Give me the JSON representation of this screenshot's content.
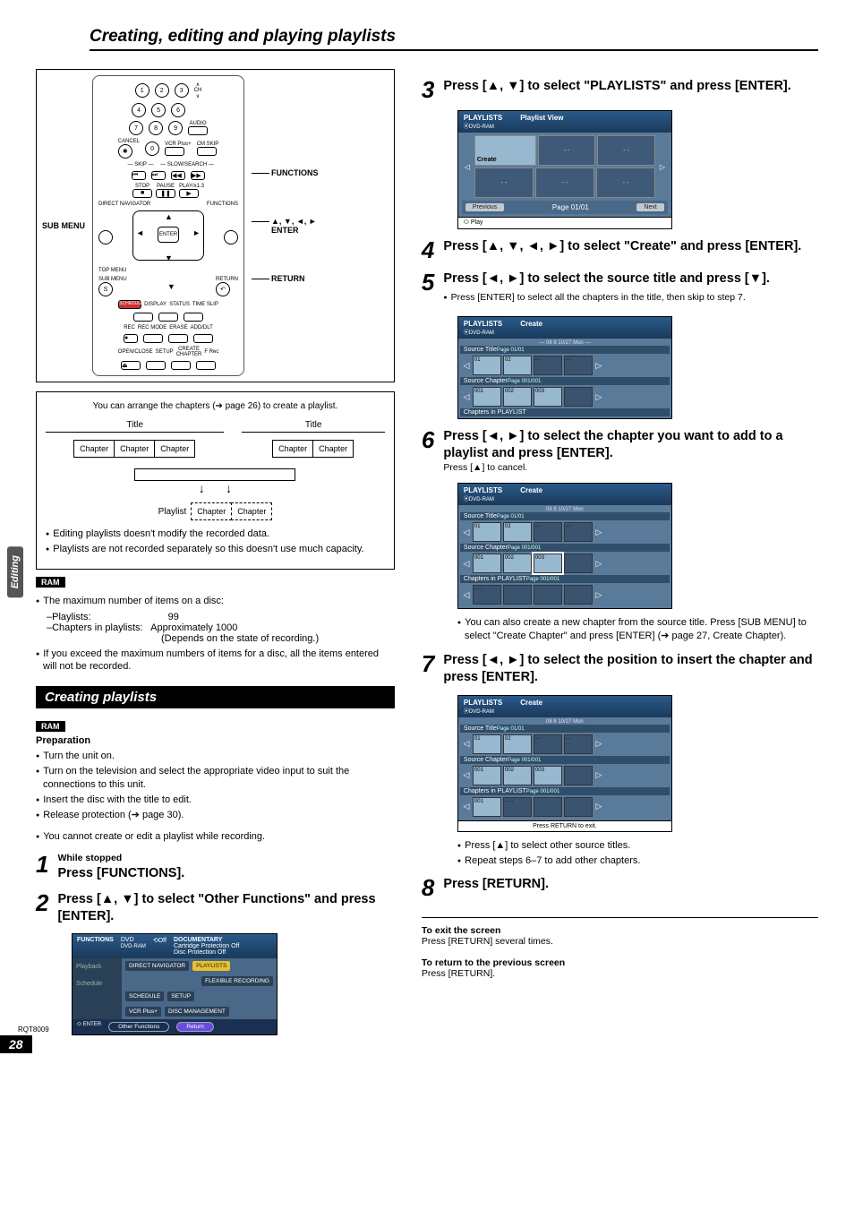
{
  "page": {
    "title": "Creating, editing and playing playlists",
    "side_tab": "Editing",
    "footer_code": "RQT8009",
    "page_number": "28"
  },
  "remote_labels": {
    "sub_menu": "SUB MENU",
    "functions": "FUNCTIONS",
    "arrows_enter": "▲, ▼, ◄, ►\nENTER",
    "return": "RETURN",
    "enter_btn": "ENTER"
  },
  "explain": {
    "intro": "You can arrange the chapters (➔ page 26) to create a playlist.",
    "title_label": "Title",
    "chapter_label": "Chapter",
    "playlist_label": "Playlist",
    "points": [
      "Editing playlists doesn't modify the recorded data.",
      "Playlists are not recorded separately so this doesn't use much capacity."
    ]
  },
  "ram_info": {
    "line1": "The maximum number of items on a disc:",
    "pl_label": "–Playlists:",
    "pl_val": "99",
    "ch_label": "–Chapters in playlists:",
    "ch_val": "Approximately 1000",
    "ch_note": "(Depends on the state of recording.)",
    "line2": "If you exceed the maximum numbers of items for a disc, all the items entered will not be recorded."
  },
  "section_header": "Creating playlists",
  "prep": {
    "label": "Preparation",
    "items": [
      "Turn the unit on.",
      "Turn on the television and select the appropriate video input to suit the connections to this unit.",
      "Insert the disc with the title to edit.",
      "Release protection (➔ page 30)."
    ],
    "note": "You cannot create or edit a playlist while recording."
  },
  "steps": {
    "s1_pre": "While stopped",
    "s1": "Press [FUNCTIONS].",
    "s2": "Press [▲, ▼] to select \"Other Functions\" and press [ENTER].",
    "s3": "Press [▲, ▼] to select \"PLAYLISTS\" and press [ENTER].",
    "s4": "Press [▲, ▼, ◄, ►] to select \"Create\" and press [ENTER].",
    "s5": "Press [◄, ►] to select the source title and press [▼].",
    "s5_sub": "Press [ENTER] to select all the chapters in the title, then skip to step 7.",
    "s6": "Press [◄, ►] to select the chapter you want to add to a playlist and press [ENTER].",
    "s6_sub": "Press [▲] to cancel.",
    "s6_note": "You can also create a new chapter from the source title. Press [SUB MENU] to select \"Create Chapter\" and press [ENTER] (➔ page 27, Create Chapter).",
    "s7": "Press [◄, ►] to select the position to insert the chapter and press [ENTER].",
    "s7_n1": "Press [▲] to select other source titles.",
    "s7_n2": "Repeat steps 6–7 to add other chapters.",
    "s8": "Press [RETURN]."
  },
  "exit": {
    "h1": "To exit the screen",
    "t1": "Press [RETURN] several times.",
    "h2": "To return to the previous screen",
    "t2": "Press [RETURN]."
  },
  "osd_playlist_view": {
    "pl": "PLAYLISTS",
    "ram": "DVD-RAM",
    "view": "Playlist View",
    "create": "Create",
    "prev": "Previous",
    "page": "Page 01/01",
    "next": "Next",
    "play": "Play"
  },
  "osd_create": {
    "pl": "PLAYLISTS",
    "ram": "DVD-RAM",
    "create": "Create",
    "date": "08 8 10/27 Mon",
    "src_title": "Source Title",
    "src_chapter": "Source Chapter",
    "in_pl": "Chapters in PLAYLIST",
    "page1": "Page 01/01",
    "page2": "Page 001/001",
    "return_note": "Press RETURN to exit.",
    "t01": "01",
    "t02": "02",
    "c001": "001",
    "c002": "002",
    "c003": "003"
  },
  "osd_func": {
    "functions": "FUNCTIONS",
    "dvd": "DVD",
    "ram": "DVD-RAM",
    "off": "Off",
    "doc": "DOCUMENTARY",
    "cart": "Cartridge Protection   Off",
    "disc_prot": "Disc Protection   Off",
    "playback": "Playback",
    "schedule": "Schedule",
    "dn": "DIRECT NAVIGATOR",
    "pl": "PLAYLISTS",
    "flex": "FLEXIBLE RECORDING",
    "sched": "SCHEDULE",
    "vcr": "VCR Plus+",
    "setup": "SETUP",
    "dm": "DISC MANAGEMENT",
    "other": "Other Functions",
    "return": "Return",
    "enter": "ENTER"
  }
}
